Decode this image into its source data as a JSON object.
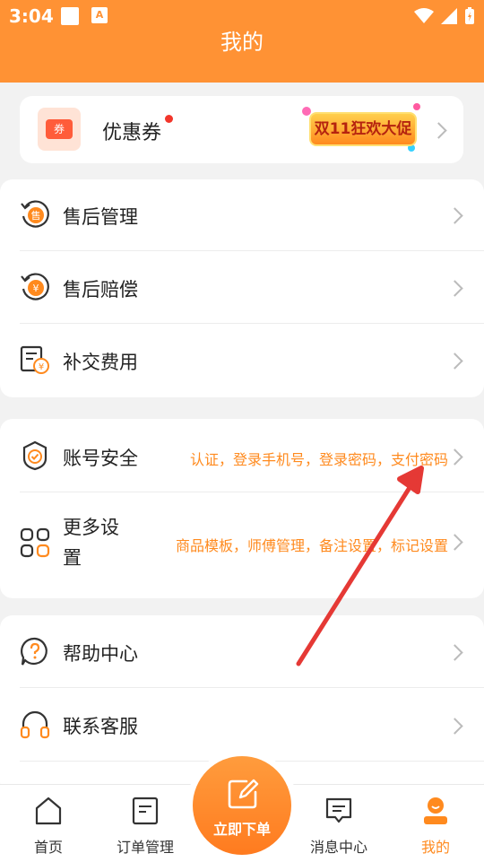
{
  "status_bar": {
    "time": "3:04",
    "notification_badge": "A"
  },
  "header": {
    "title": "我的"
  },
  "coupon": {
    "label": "优惠券",
    "icon_text": "券",
    "promo_text": "双11狂欢大促"
  },
  "service_section": [
    {
      "label": "售后管理",
      "icon": "after-sale-icon",
      "icon_text": "售"
    },
    {
      "label": "售后赔偿",
      "icon": "compensation-icon",
      "icon_text": "¥"
    },
    {
      "label": "补交费用",
      "icon": "fee-icon"
    }
  ],
  "settings_section": [
    {
      "label": "账号安全",
      "icon": "shield-icon",
      "hint": "认证，登录手机号，登录密码，支付密码"
    },
    {
      "label": "更多设\n置",
      "label_line1": "更多设",
      "label_line2": "置",
      "icon": "grid-icon",
      "hint": "商品模板，师傅管理，备注设置，标记设置"
    }
  ],
  "help_section": [
    {
      "label": "帮助中心",
      "icon": "help-icon"
    },
    {
      "label": "联系客服",
      "icon": "headset-icon"
    }
  ],
  "tabbar": {
    "tabs": [
      {
        "label": "首页",
        "icon": "home-icon",
        "active": false
      },
      {
        "label": "订单管理",
        "icon": "order-icon",
        "active": false
      },
      {
        "label": "消息中心",
        "icon": "message-icon",
        "active": false
      },
      {
        "label": "我的",
        "icon": "profile-icon",
        "active": true
      }
    ],
    "fab_label": "立即下单"
  },
  "colors": {
    "accent": "#ff9234",
    "hint": "#ff8a1e",
    "annotation_arrow": "#e53935"
  }
}
